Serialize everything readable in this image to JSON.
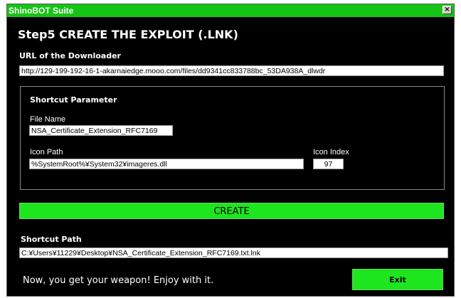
{
  "window": {
    "title": "ShinoBOT Suite",
    "close_glyph": "×"
  },
  "heading": "Step5 CREATE THE EXPLOIT (.LNK)",
  "downloader": {
    "label": "URL of the Downloader",
    "value": "http://129-199-192-16-1-akarnaiedge.mooo.com/files/dd9341cc833788bc_53DA938A_dlwdr"
  },
  "shortcut_params": {
    "group_label": "Shortcut Parameter",
    "file_name_label": "File Name",
    "file_name_value": "NSA_Certificate_Extension_RFC7169",
    "icon_path_label": "Icon Path",
    "icon_path_value": "%SystemRoot%¥System32¥imageres.dll",
    "icon_index_label": "Icon Index",
    "icon_index_value": "97"
  },
  "create_label": "CREATE",
  "shortcut_path": {
    "label": "Shortcut Path",
    "value": "C:¥Users¥11229¥Desktop¥NSA_Certificate_Extension_RFC7169.txt.lnk"
  },
  "footer_message": "Now, you get your weapon! Enjoy with it.",
  "exit_label": "Exit",
  "colors": {
    "accent": "#1ee61e",
    "titlebar": "#16c416",
    "background": "#000000"
  }
}
